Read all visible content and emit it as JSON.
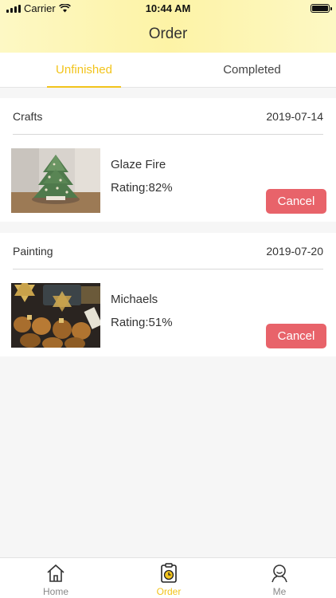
{
  "status_bar": {
    "carrier": "Carrier",
    "time": "10:44 AM"
  },
  "header": {
    "title": "Order"
  },
  "tabs": [
    {
      "label": "Unfinished",
      "active": true
    },
    {
      "label": "Completed",
      "active": false
    }
  ],
  "orders": [
    {
      "category": "Crafts",
      "date": "2019-07-14",
      "name": "Glaze Fire",
      "rating": "Rating:82%",
      "cancel_label": "Cancel"
    },
    {
      "category": "Painting",
      "date": "2019-07-20",
      "name": "Michaels",
      "rating": "Rating:51%",
      "cancel_label": "Cancel"
    }
  ],
  "tabbar": [
    {
      "label": "Home",
      "icon": "home-icon",
      "active": false
    },
    {
      "label": "Order",
      "icon": "order-icon",
      "active": true
    },
    {
      "label": "Me",
      "icon": "user-icon",
      "active": false
    }
  ],
  "colors": {
    "accent": "#f2c41c",
    "cancel": "#e8636a",
    "header_bg": "#fdf5b0"
  }
}
